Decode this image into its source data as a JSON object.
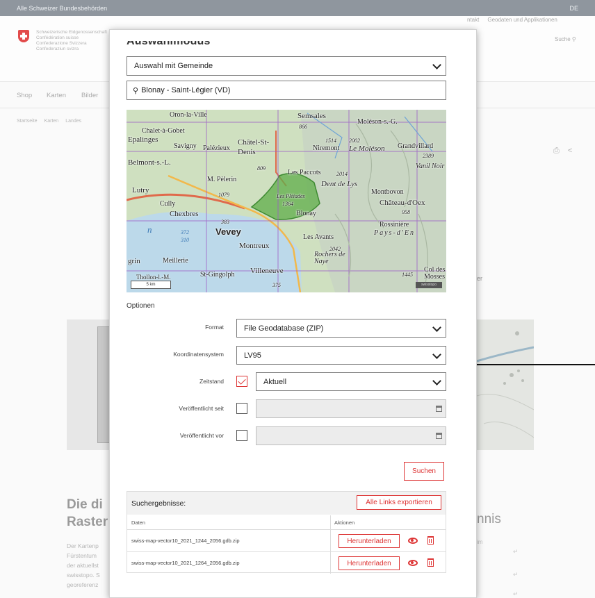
{
  "topbar": {
    "left": "Alle Schweizer Bundesbehörden",
    "lang": "DE"
  },
  "header": {
    "logo_lines": [
      "Schweizerische Eidgenossenschaft",
      "Confédération suisse",
      "Confederazione Svizzera",
      "Confederaziun svizra"
    ],
    "topnav": [
      "ntakt",
      "Geodaten und Applikationen"
    ],
    "search": "Suche"
  },
  "menu": [
    "Shop",
    "Karten",
    "Bilder"
  ],
  "crumbs": [
    "Startseite",
    "Karten",
    "Landes"
  ],
  "background": {
    "side_text": "er",
    "title_line1": "Die di",
    "title_line2": "Raster",
    "para": [
      "Der Kartenp",
      "Fürstentum",
      "der aktuellst",
      "swisstopo. S",
      "georeferenz"
    ],
    "right_title": "nnis",
    "right_small": "im"
  },
  "modal": {
    "title": "Auswahlmodus",
    "mode_value": "Auswahl mit Gemeinde",
    "search_value": "Blonay - Saint-Légier (VD)",
    "map_labels": [
      "Oron-la-Ville",
      "Semsales",
      "Moléson-s.-G.",
      "Chalet-à-Gobet",
      "Epalinges",
      "Savigny",
      "Palézieux",
      "Châtel-St-Denis",
      "Niremont",
      "Le Moléson",
      "Grandvillard",
      "Belmont-s.-L.",
      "Les Paccots",
      "Dent de Lys",
      "Vanil Noir",
      "M. Pèlerin",
      "Lutry",
      "Montbovon",
      "Cully",
      "Chexbres",
      "Les Pléiades",
      "Blonay",
      "Château-d'Oex",
      "Rossinière",
      "Vevey",
      "Montreux",
      "Pays-d'En",
      "Les Avants",
      "Rochers de Naye",
      "grin",
      "Meillerie",
      "St-Gingolph",
      "Villeneuve",
      "Col des Mosses",
      "Thollon-l.-M."
    ],
    "map_numbers": [
      "866",
      "1514",
      "2002",
      "2389",
      "809",
      "2014",
      "1079",
      "958",
      "1364",
      "383",
      "372",
      "310",
      "2042",
      "1445",
      "375"
    ],
    "map_water": "n",
    "scale": "5 km",
    "copyright": "swisstopo",
    "options_title": "Optionen",
    "format_label": "Format",
    "format_value": "File Geodatabase (ZIP)",
    "crs_label": "Koordinatensystem",
    "crs_value": "LV95",
    "zeitstand_label": "Zeitstand",
    "zeitstand_value": "Aktuell",
    "pub_since_label": "Veröffentlicht seit",
    "pub_before_label": "Veröffentlicht vor",
    "search_button": "Suchen",
    "results_title": "Suchergebnisse:",
    "export_button": "Alle Links exportieren",
    "col_data": "Daten",
    "col_actions": "Aktionen",
    "rows": [
      {
        "file": "swiss-map-vector10_2021_1244_2056.gdb.zip",
        "download": "Herunterladen"
      },
      {
        "file": "swiss-map-vector10_2021_1264_2056.gdb.zip",
        "download": "Herunterladen"
      }
    ]
  },
  "colors": {
    "accent_red": "#dd3333",
    "overlay": "#8f969e",
    "map_selection": "#5fae4a"
  }
}
